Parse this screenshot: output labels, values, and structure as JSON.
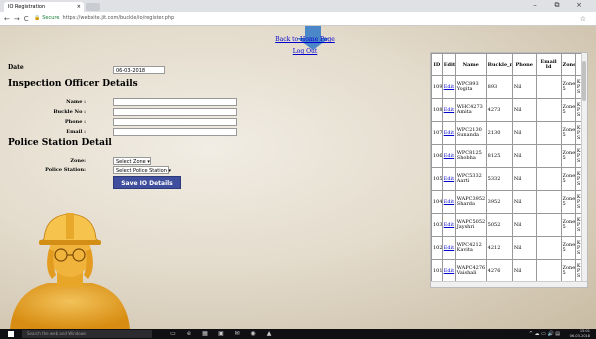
{
  "browser": {
    "tab_title": "IO Registration",
    "tab_close": "×",
    "window_controls": [
      "–",
      "⧉",
      "×"
    ],
    "nav_icons": [
      "←",
      "→",
      "C"
    ],
    "secure_label": "Secure",
    "url": "https://website.jit.com/buckle/io/register.php",
    "star": "☆"
  },
  "links": {
    "back_home": "Back to Home Page",
    "logout": "Log Out"
  },
  "form": {
    "date_label": "Date",
    "date_value": "06-03-2018",
    "inspection_heading": "Inspection Officer Details",
    "name_label": "Name :",
    "buckle_label": "Buckle No :",
    "phone_label": "Phone :",
    "email_label": "Email :",
    "police_heading": "Police Station Detail",
    "zone_label": "Zone:",
    "zone_value": "Select Zone ▾",
    "station_label": "Police Station:",
    "station_value": "Select Police Station ▾",
    "save_label": "Save IO Details"
  },
  "table": {
    "headers": [
      "ID",
      "Edit",
      "Name",
      "Buckle_no",
      "Phone",
      "Email Id",
      "Zone",
      ""
    ],
    "rows": [
      {
        "id": "109",
        "edit": "Edit",
        "name": "WPC893 Yogita",
        "buckle": "893",
        "phone": "Nil",
        "email": "",
        "zone": "Zone 5",
        "extra": "K P S"
      },
      {
        "id": "108",
        "edit": "Edit",
        "name": "WHC4273 Amita",
        "buckle": "4273",
        "phone": "Nil",
        "email": "",
        "zone": "Zone 5",
        "extra": "K P S"
      },
      {
        "id": "107",
        "edit": "Edit",
        "name": "WPC2130 Sunanda",
        "buckle": "2130",
        "phone": "Nil",
        "email": "",
        "zone": "Zone 5",
        "extra": "K P S"
      },
      {
        "id": "106",
        "edit": "Edit",
        "name": "WPC8125 Shobha",
        "buckle": "8125",
        "phone": "Nil",
        "email": "",
        "zone": "Zone 5",
        "extra": "K P S"
      },
      {
        "id": "105",
        "edit": "Edit",
        "name": "WPC5332 Aarti",
        "buckle": "5332",
        "phone": "Nil",
        "email": "",
        "zone": "Zone 5",
        "extra": "K P S"
      },
      {
        "id": "104",
        "edit": "Edit",
        "name": "WAPC3952 Sharda",
        "buckle": "3952",
        "phone": "Nil",
        "email": "",
        "zone": "Zone 5",
        "extra": "K P S"
      },
      {
        "id": "103",
        "edit": "Edit",
        "name": "WAPC5052 Jayshri",
        "buckle": "5052",
        "phone": "Nil",
        "email": "",
        "zone": "Zone 5",
        "extra": "K P S"
      },
      {
        "id": "102",
        "edit": "Edit",
        "name": "WPC4212 Kavita",
        "buckle": "4212",
        "phone": "Nil",
        "email": "",
        "zone": "Zone 5",
        "extra": "K P S"
      },
      {
        "id": "101",
        "edit": "Edit",
        "name": "WAPC4276 Vaishali",
        "buckle": "4276",
        "phone": "Nil",
        "email": "",
        "zone": "Zone 5",
        "extra": "K P S"
      }
    ]
  },
  "taskbar": {
    "search_placeholder": "Search the web and Windows",
    "apps": [
      "▭",
      "e",
      "▦",
      "▣",
      "✉",
      "◉",
      "▲"
    ],
    "tray_icons": "^ ☁ ▭ 🔊 ▤",
    "time": "15:01",
    "date": "06-03-2018"
  },
  "colors": {
    "save_button": "#3f4f9e",
    "arrow": "#4a86c8",
    "figure": "#e3a323"
  }
}
